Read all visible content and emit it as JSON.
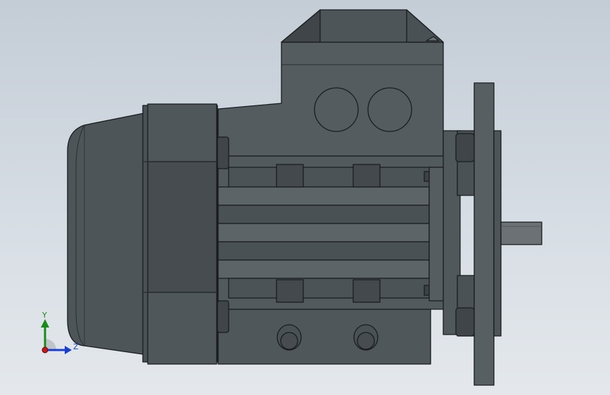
{
  "triad": {
    "y_label": "Y",
    "z_label": "Z"
  },
  "colors": {
    "background_top": "#c4ccd6",
    "background_bottom": "#e4e8ec",
    "motor_body": "#555c60",
    "motor_dark": "#3f4548",
    "motor_light": "#6a7175",
    "flange": "#5a6064",
    "shaft": "#6b7175",
    "outline": "#1a1d1f",
    "axis_y": "#1a8a1a",
    "axis_z": "#1a3fd0",
    "axis_origin": "#c81818"
  },
  "parts": [
    "fan-cover",
    "end-shield",
    "terminal-box",
    "stator-housing",
    "flange",
    "output-shaft",
    "mounting-foot"
  ]
}
